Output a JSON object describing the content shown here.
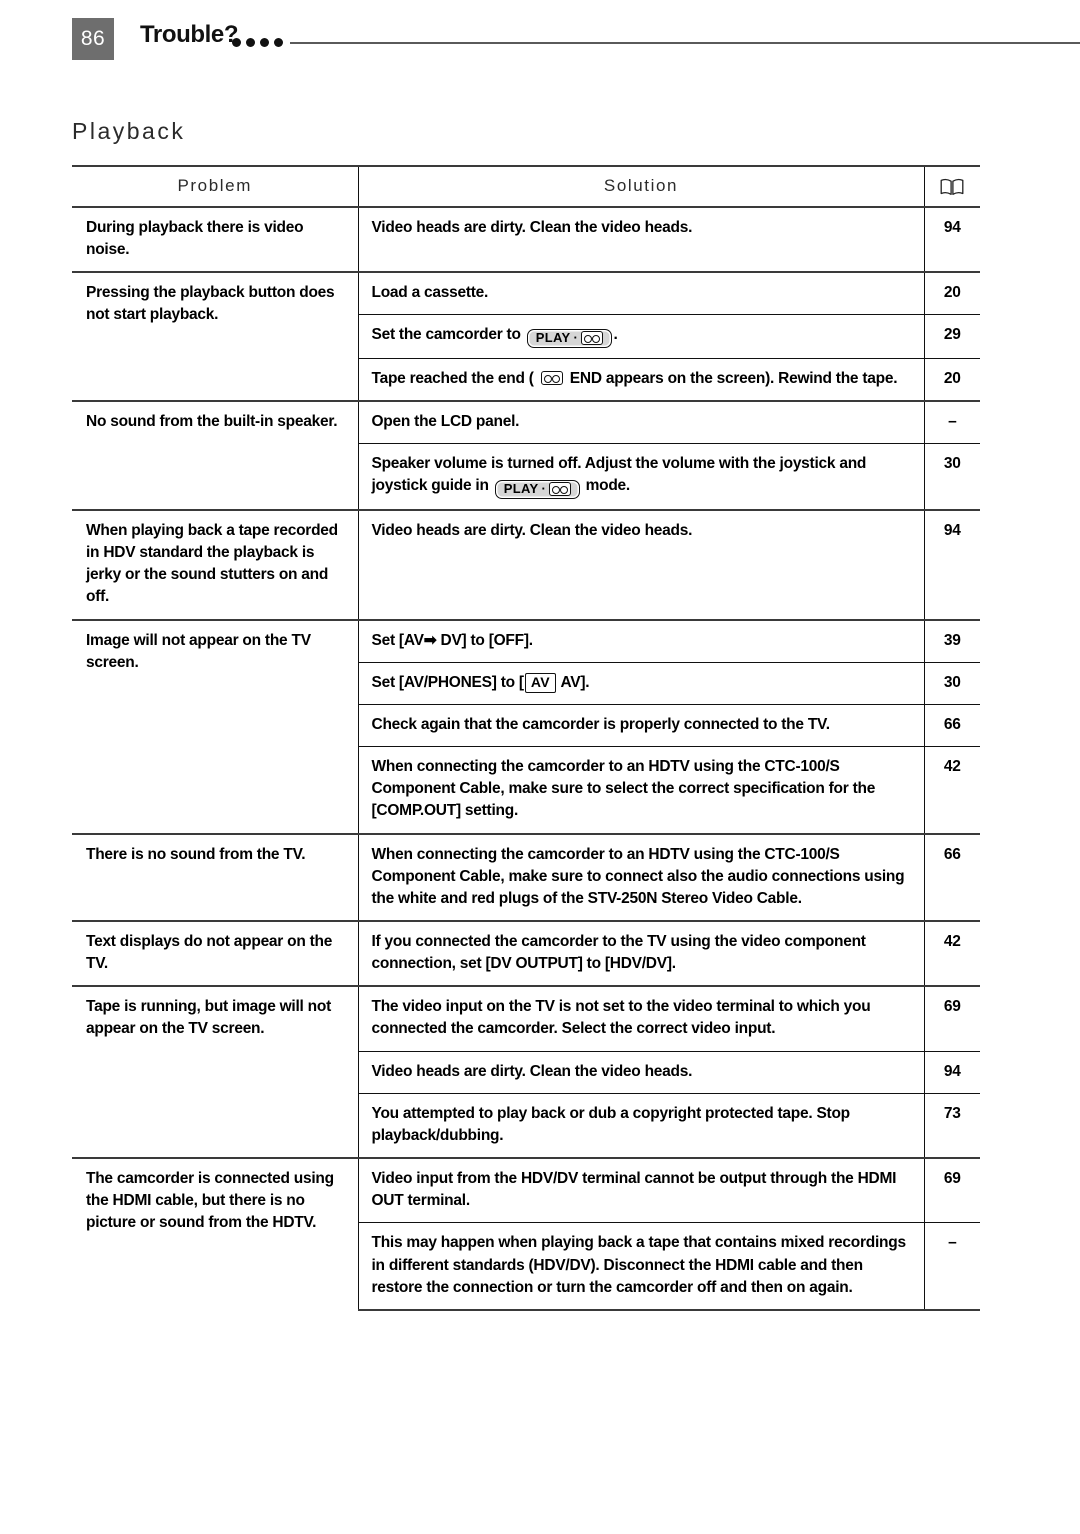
{
  "header": {
    "page_number": "86",
    "chapter_title": "Trouble?",
    "dot_count": 4,
    "accent_gray": "#6e6e6e"
  },
  "section": {
    "title": "Playback"
  },
  "table": {
    "columns": {
      "problem": "Problem",
      "solution": "Solution",
      "page_ref_icon": "open-book-icon"
    },
    "groups": [
      {
        "problem": "During playback there is video noise.",
        "rows": [
          {
            "solution": "Video heads are dirty. Clean the video heads.",
            "page": "94"
          }
        ]
      },
      {
        "problem": "Pressing the playback button does not start playback.",
        "rows": [
          {
            "solution": "Load a cassette.",
            "page": "20"
          },
          {
            "solution_pre": "Set the camcorder to ",
            "graphic": "play-tape-button",
            "solution_post": ".",
            "page": "29"
          },
          {
            "solution_pre": "Tape reached the end ( ",
            "graphic": "tape-icon",
            "solution_post": " END  appears on the screen). Rewind the tape.",
            "page": "20"
          }
        ]
      },
      {
        "problem": "No sound from the built-in speaker.",
        "rows": [
          {
            "solution": "Open the LCD panel.",
            "page": "–"
          },
          {
            "solution_pre": "Speaker volume is turned off. Adjust the volume with the joystick and joystick guide in ",
            "graphic": "play-tape-button",
            "solution_post": " mode.",
            "page": "30"
          }
        ]
      },
      {
        "problem": "When playing back a tape recorded in HDV standard the playback is jerky or the sound stutters on and off.",
        "rows": [
          {
            "solution": "Video heads are dirty. Clean the video heads.",
            "page": "94"
          }
        ]
      },
      {
        "problem": "Image will not appear on the TV screen.",
        "rows": [
          {
            "solution": "Set [AV➡ DV] to [OFF].",
            "page": "39"
          },
          {
            "solution_pre": "Set [AV/PHONES] to [",
            "graphic": "av-icon",
            "solution_post": " AV].",
            "page": "30"
          },
          {
            "solution": "Check again that the camcorder is properly connected to the TV.",
            "page": "66"
          },
          {
            "solution": "When connecting the camcorder to an HDTV using the CTC-100/S Component Cable, make sure to select the correct specification for the [COMP.OUT] setting.",
            "page": "42"
          }
        ]
      },
      {
        "problem": "There is no sound from the TV.",
        "rows": [
          {
            "solution": "When connecting the camcorder to an HDTV using the CTC-100/S Component Cable, make sure to connect also the audio connections using the white and red plugs of the STV-250N Stereo Video Cable.",
            "page": "66"
          }
        ]
      },
      {
        "problem": "Text displays do not appear on the TV.",
        "rows": [
          {
            "solution": "If you connected the camcorder to the TV using the video component connection, set [DV OUTPUT] to [HDV/DV].",
            "page": "42"
          }
        ]
      },
      {
        "problem": "Tape is running, but image will not appear on the TV screen.",
        "rows": [
          {
            "solution": "The video input on the TV is not set to the video terminal to which you connected the camcorder. Select the correct video input.",
            "page": "69"
          },
          {
            "solution": "Video heads are dirty. Clean the video heads.",
            "page": "94"
          },
          {
            "solution": "You attempted to play back or dub a copyright protected tape. Stop playback/dubbing.",
            "page": "73"
          }
        ]
      },
      {
        "problem": "The camcorder is connected using the HDMI cable, but there is no picture or sound from the HDTV.",
        "rows": [
          {
            "solution": "Video input from the HDV/DV terminal cannot be output through the HDMI OUT terminal.",
            "page": "69"
          },
          {
            "solution": "This may happen when playing back a tape that contains mixed recordings in different standards (HDV/DV). Disconnect the HDMI cable and then restore the connection or turn the camcorder off and then on again.",
            "page": "–"
          }
        ]
      }
    ],
    "graphics": {
      "play_button_label": "PLAY",
      "play_button_dot": "·",
      "av_label": "AV"
    }
  }
}
